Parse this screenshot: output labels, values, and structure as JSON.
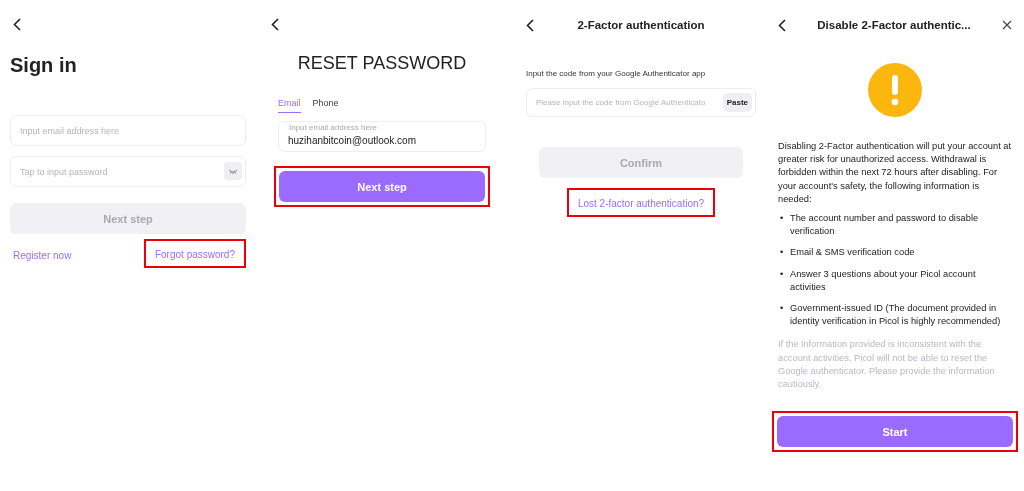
{
  "sign_in": {
    "title": "Sign in",
    "email": {
      "placeholder": "Input email address here"
    },
    "password": {
      "placeholder": "Tap to input password"
    },
    "submit": {
      "label": "Next step",
      "disabled": true,
      "highlighted": false
    },
    "links": [
      {
        "label": "Register now",
        "highlighted": false
      },
      {
        "label": "Forgot password?",
        "highlighted": true
      }
    ]
  },
  "reset_password": {
    "title": "RESET PASSWORD",
    "tabs": [
      {
        "label": "Email",
        "selected": true
      },
      {
        "label": "Phone",
        "selected": false
      }
    ],
    "email": {
      "label": "Input email address here",
      "value": "huzihanbitcoin@outlook.com"
    },
    "submit": {
      "label": "Next step",
      "disabled": false,
      "highlighted": true
    }
  },
  "two_factor": {
    "title": "2-Factor authentication",
    "instruction": "Input the code from your Google Authenticator app",
    "code": {
      "placeholder": "Please input the code from Google Authenticato"
    },
    "paste": "Paste",
    "submit": {
      "label": "Confirm",
      "disabled": true,
      "highlighted": false
    },
    "link": {
      "label": "Lost 2-factor authentication?",
      "highlighted": true
    }
  },
  "disable_two_factor": {
    "title": "Disable 2-Factor authentic...",
    "warning": "Disabling 2-Factor authentication will put your account at greater risk for unauthorized access. Withdrawal is forbidden within the next 72 hours after disabling. For your account's safety, the following information is needed:",
    "requirements": [
      {
        "bullet": "•",
        "text": "The account number and password to disable verification"
      },
      {
        "bullet": "•",
        "text": "Email & SMS verification code"
      },
      {
        "bullet": "•",
        "text": "Answer 3 questions about your Picol account activities"
      },
      {
        "bullet": "•",
        "text": "Government-issued ID (The document provided in identity verification in Picol is highly recommended)"
      }
    ],
    "note": "If the information provided is inconsistent with the account activities, Picol will not be able to reset the Google authenticator. Please provide the information cautiously.",
    "submit": {
      "label": "Start",
      "disabled": false,
      "highlighted": true
    }
  }
}
